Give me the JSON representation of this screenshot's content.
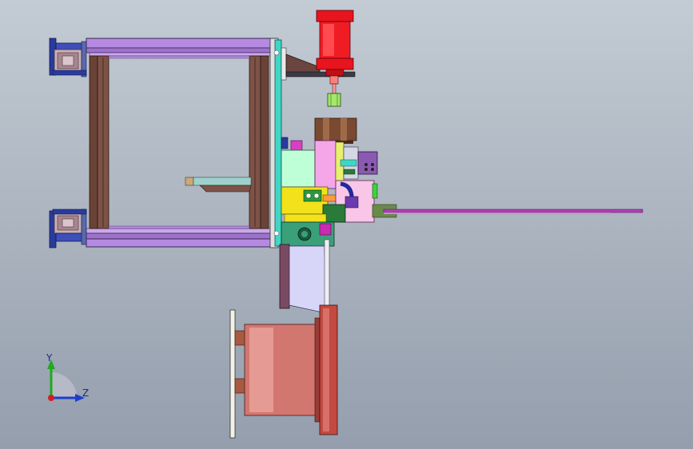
{
  "viewport": {
    "background_top": "#c3cbd4",
    "background_bottom": "#949ead"
  },
  "triad": {
    "y_label": "Y",
    "z_label": "Z",
    "y_color": "#1faa1f",
    "z_color": "#1f3ed1",
    "x_color": "#d11f1f"
  },
  "model": {
    "frame_color": "#b58ae0",
    "post_color": "#6b4236",
    "plate_color": "#3fd6c4",
    "cylinder_color": "#e8141e",
    "motor_color": "#d27670",
    "rod_color": "#b23fb8"
  }
}
